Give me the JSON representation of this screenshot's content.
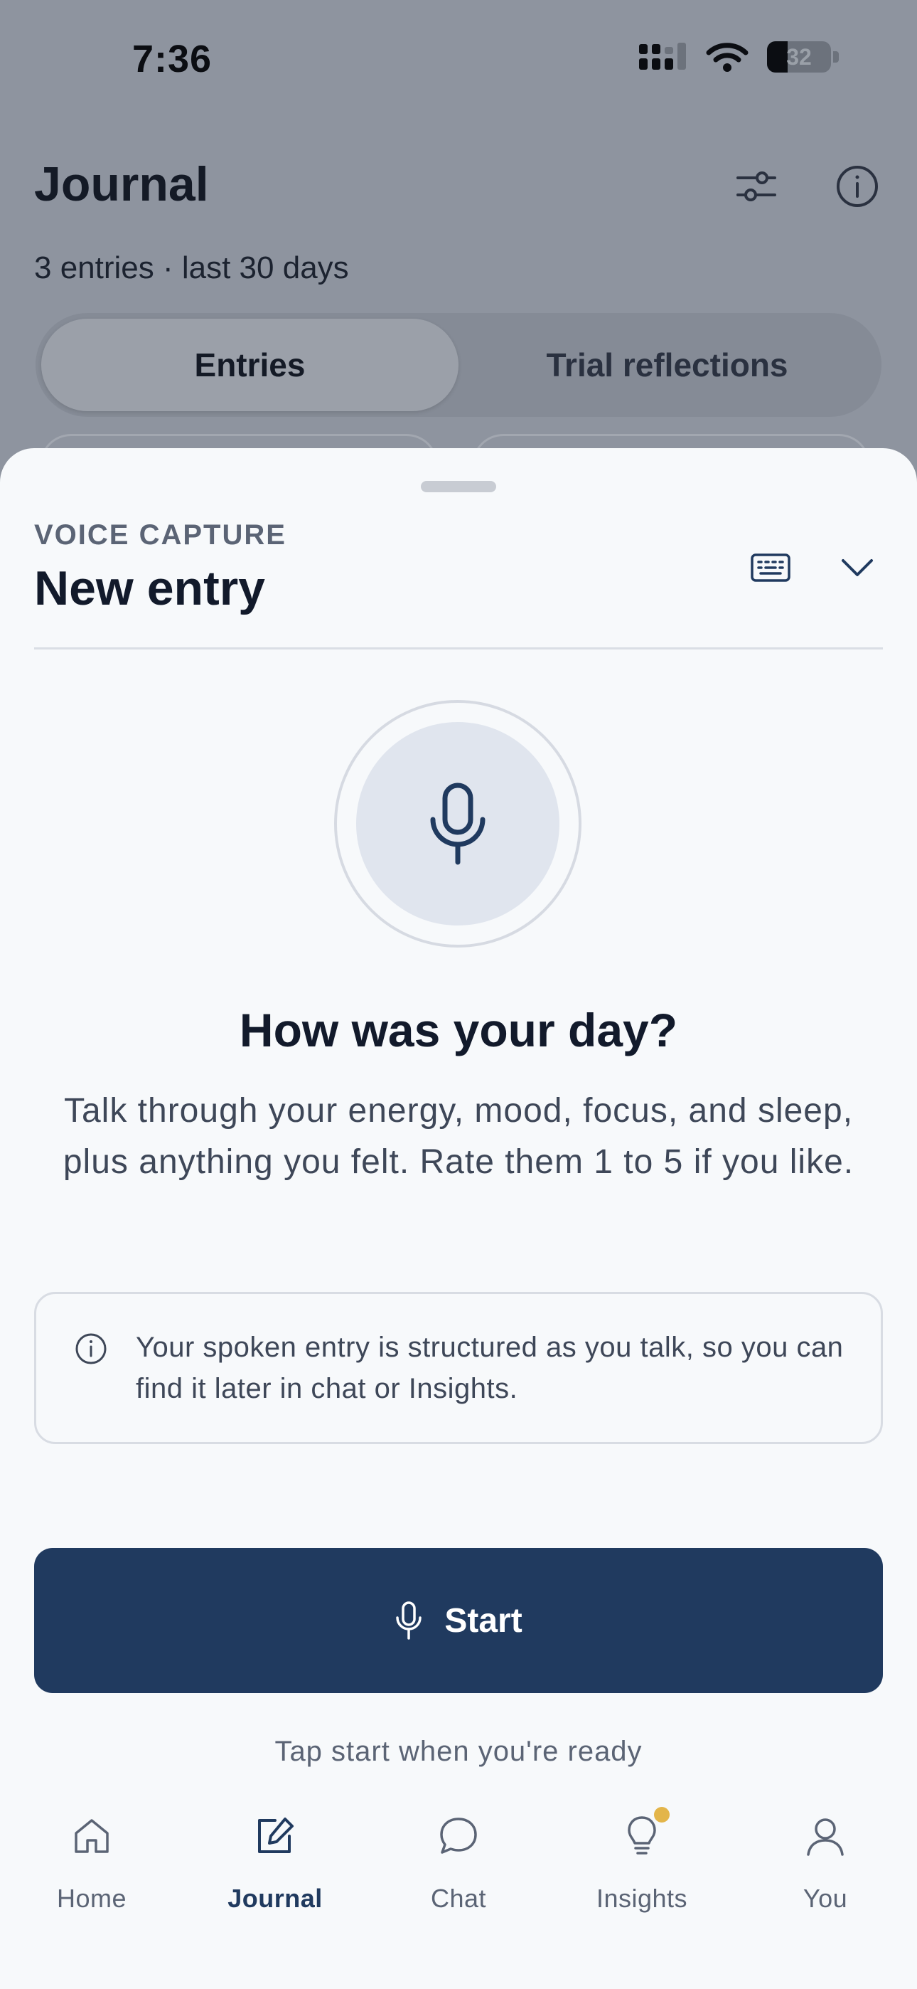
{
  "status_bar": {
    "time": "7:36",
    "battery": "32"
  },
  "header": {
    "title": "Journal",
    "subtitle": "3 entries · last 30 days"
  },
  "segments": {
    "entries": "Entries",
    "trial": "Trial reflections",
    "selected": "Entries"
  },
  "sheet": {
    "eyebrow": "VOICE CAPTURE",
    "title": "New entry",
    "prompt_title": "How was your day?",
    "prompt_body": "Talk through your energy, mood, focus, and sleep, plus anything you felt. Rate them 1 to 5 if you like.",
    "info_text": "Your spoken entry is structured as you talk, so you can find it later in chat or Insights.",
    "start_label": "Start",
    "start_hint": "Tap start when you're ready"
  },
  "tabbar": {
    "items": [
      {
        "label": "Home",
        "icon": "home-icon"
      },
      {
        "label": "Journal",
        "icon": "edit-icon"
      },
      {
        "label": "Chat",
        "icon": "chat-bubble-icon"
      },
      {
        "label": "Insights",
        "icon": "lightbulb-icon"
      },
      {
        "label": "You",
        "icon": "user-icon"
      }
    ],
    "active": "Journal"
  },
  "colors": {
    "accent": "#203a5f",
    "notification_dot": "#e3b54a",
    "sheet_background": "#f7f9fb",
    "scrim": "#8e949f"
  }
}
